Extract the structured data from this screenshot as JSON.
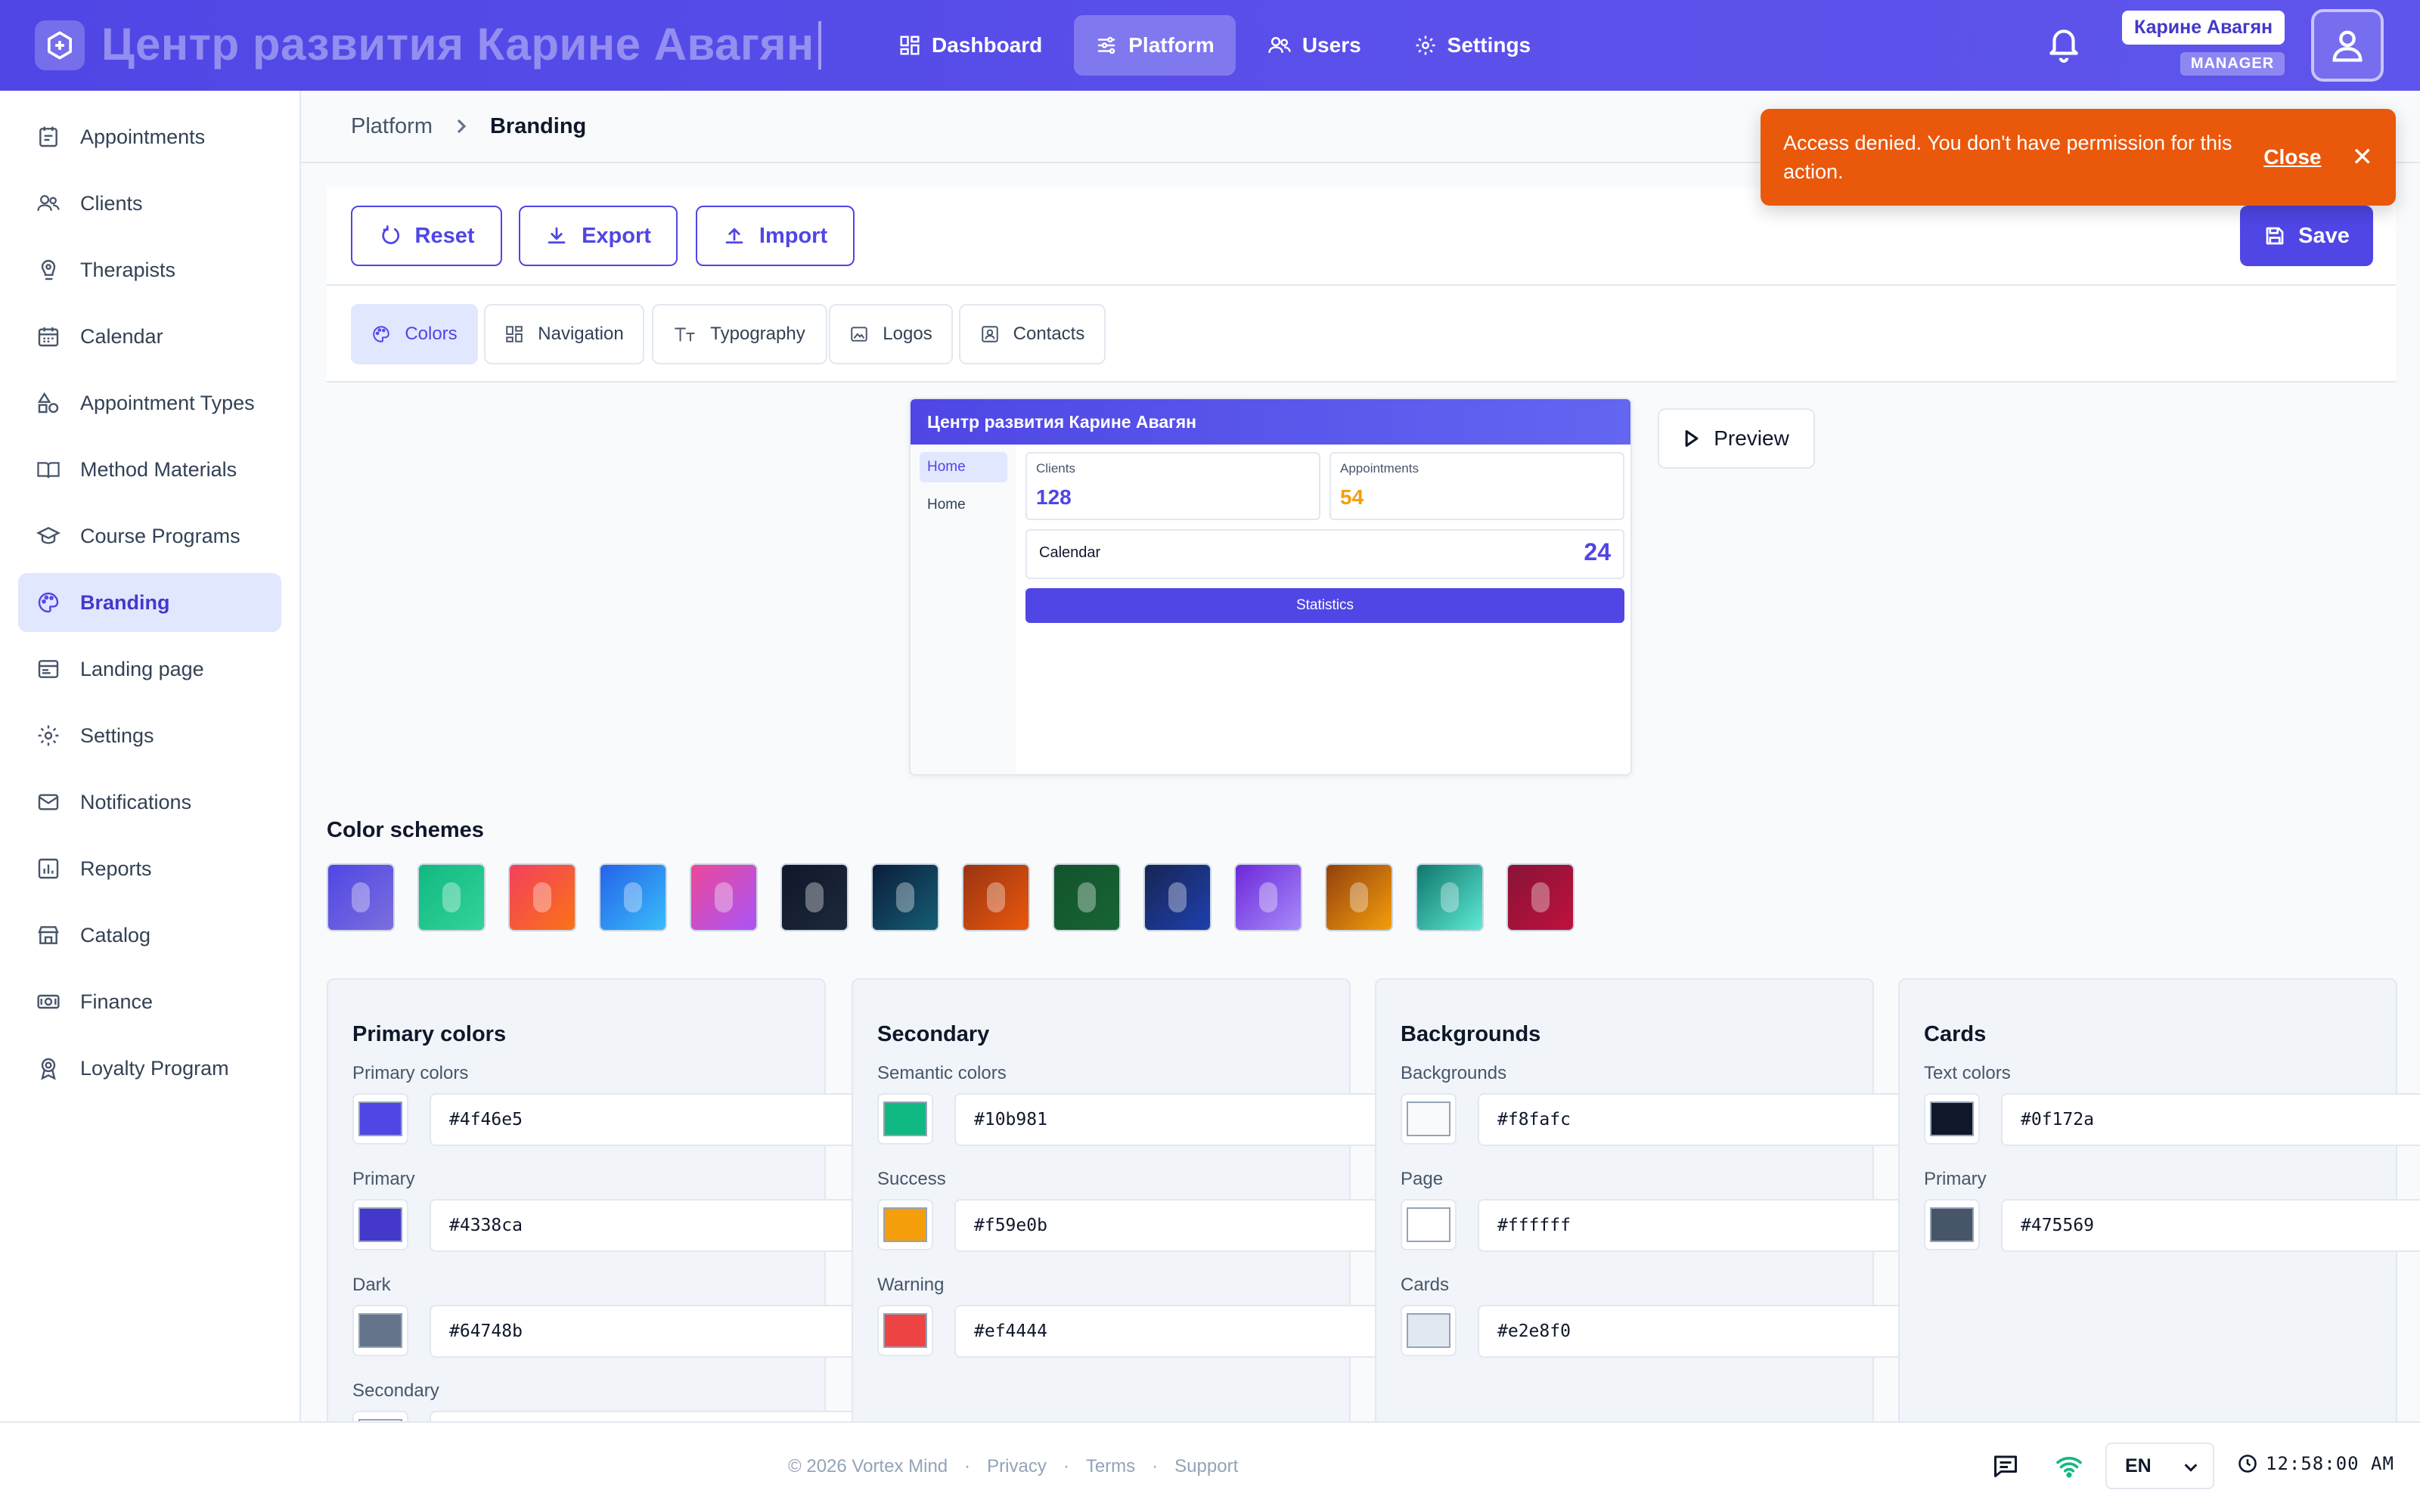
{
  "header": {
    "app_title": "Центр развития Карине Авагян",
    "nav": [
      {
        "label": "Dashboard",
        "icon": "dashboard-icon"
      },
      {
        "label": "Platform",
        "icon": "sliders-icon"
      },
      {
        "label": "Users",
        "icon": "users-icon"
      },
      {
        "label": "Settings",
        "icon": "gear-icon"
      }
    ],
    "active_nav": "Platform",
    "user": {
      "name": "Карине Авагян",
      "role": "MANAGER"
    }
  },
  "sidebar": {
    "items": [
      {
        "label": "Appointments",
        "icon": "appointments-icon"
      },
      {
        "label": "Clients",
        "icon": "clients-icon"
      },
      {
        "label": "Therapists",
        "icon": "therapists-icon"
      },
      {
        "label": "Calendar",
        "icon": "calendar-icon"
      },
      {
        "label": "Appointment Types",
        "icon": "shapes-icon"
      },
      {
        "label": "Method Materials",
        "icon": "book-icon"
      },
      {
        "label": "Course Programs",
        "icon": "graduation-cap-icon"
      },
      {
        "label": "Branding",
        "icon": "palette-icon"
      },
      {
        "label": "Landing page",
        "icon": "browser-icon"
      },
      {
        "label": "Settings",
        "icon": "gear-icon"
      },
      {
        "label": "Notifications",
        "icon": "mail-icon"
      },
      {
        "label": "Reports",
        "icon": "chart-icon"
      },
      {
        "label": "Catalog",
        "icon": "store-icon"
      },
      {
        "label": "Finance",
        "icon": "money-icon"
      },
      {
        "label": "Loyalty Program",
        "icon": "award-icon"
      }
    ],
    "active": "Branding"
  },
  "breadcrumb": {
    "root": "Platform",
    "current": "Branding"
  },
  "toast": {
    "message": "Access denied. You don't have permission for this action.",
    "close_label": "Close",
    "color": "#ea580c"
  },
  "toolbar": {
    "reset_label": "Reset",
    "export_label": "Export",
    "import_label": "Import",
    "save_label": "Save"
  },
  "tabs": [
    {
      "label": "Colors",
      "icon": "palette-icon"
    },
    {
      "label": "Navigation",
      "icon": "grid-icon"
    },
    {
      "label": "Typography",
      "icon": "typography-icon"
    },
    {
      "label": "Logos",
      "icon": "image-icon"
    },
    {
      "label": "Contacts",
      "icon": "contact-card-icon"
    }
  ],
  "active_tab": "Colors",
  "preview": {
    "title": "Центр развития Карине Авагян",
    "side_items": [
      "Home",
      "Home"
    ],
    "cards": [
      {
        "label": "Clients",
        "value": "128",
        "color": "#4f46e5"
      },
      {
        "label": "Appointments",
        "value": "54",
        "color": "#f59e0b"
      }
    ],
    "calendar": {
      "label": "Calendar",
      "value": "24"
    },
    "stat_button": "Statistics",
    "preview_button": "Preview"
  },
  "color_schemes": {
    "title": "Color schemes",
    "swatches": [
      {
        "from": "#4f46e5",
        "to": "#7c6fdc"
      },
      {
        "from": "#10b981",
        "to": "#34d399"
      },
      {
        "from": "#f43f5e",
        "to": "#f97316"
      },
      {
        "from": "#2563eb",
        "to": "#38bdf8"
      },
      {
        "from": "#ec4899",
        "to": "#a855f7"
      },
      {
        "from": "#0f172a",
        "to": "#1e293b"
      },
      {
        "from": "#0b1d3a",
        "to": "#155e75"
      },
      {
        "from": "#9a3412",
        "to": "#ea580c"
      },
      {
        "from": "#14532d",
        "to": "#166534"
      },
      {
        "from": "#172554",
        "to": "#1e40af"
      },
      {
        "from": "#6d28d9",
        "to": "#a78bfa"
      },
      {
        "from": "#92400e",
        "to": "#f59e0b"
      },
      {
        "from": "#0f766e",
        "to": "#5eead4"
      },
      {
        "from": "#881337",
        "to": "#be123c"
      }
    ]
  },
  "groups": [
    {
      "title": "Primary colors",
      "fields": [
        {
          "label": "Primary colors",
          "value": "#4f46e5"
        },
        {
          "label": "Primary",
          "value": "#4338ca"
        },
        {
          "label": "Dark",
          "value": "#64748b"
        },
        {
          "label": "Secondary",
          "value": ""
        }
      ]
    },
    {
      "title": "Secondary",
      "fields": [
        {
          "label": "Semantic colors",
          "value": "#10b981"
        },
        {
          "label": "Success",
          "value": "#f59e0b"
        },
        {
          "label": "Warning",
          "value": "#ef4444"
        }
      ]
    },
    {
      "title": "Backgrounds",
      "fields": [
        {
          "label": "Backgrounds",
          "value": "#f8fafc"
        },
        {
          "label": "Page",
          "value": "#ffffff"
        },
        {
          "label": "Cards",
          "value": "#e2e8f0"
        }
      ]
    },
    {
      "title": "Cards",
      "fields": [
        {
          "label": "Text colors",
          "value": "#0f172a"
        },
        {
          "label": "Primary",
          "value": "#475569"
        }
      ]
    }
  ],
  "footer": {
    "copyright": "© 2026 Vortex Mind",
    "links": [
      "Privacy",
      "Terms",
      "Support"
    ],
    "language": "EN",
    "time": "12:58:00 AM"
  }
}
